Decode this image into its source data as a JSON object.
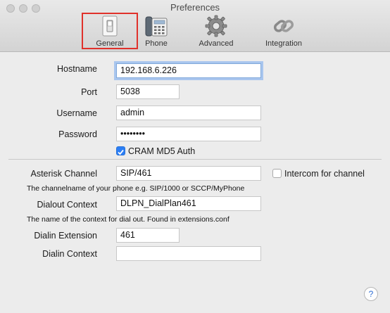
{
  "window": {
    "title": "Preferences",
    "close_button": "",
    "minimize_button": "",
    "zoom_button": ""
  },
  "toolbar": {
    "general_label": "General",
    "phone_label": "Phone",
    "advanced_label": "Advanced",
    "integration_label": "Integration",
    "selected": "General"
  },
  "general": {
    "hostname_label": "Hostname",
    "hostname_value": "192.168.6.226",
    "port_label": "Port",
    "port_value": "5038",
    "username_label": "Username",
    "username_value": "admin",
    "password_label": "Password",
    "password_value": "••••••••",
    "cram_label": "CRAM MD5 Auth",
    "cram_checked": true,
    "asterisk_channel_label": "Asterisk Channel",
    "asterisk_channel_value": "SIP/461",
    "intercom_label": "Intercom for channel",
    "intercom_checked": false,
    "channel_hint": "The channelname of your phone e.g. SIP/1000 or SCCP/MyPhone",
    "dialout_context_label": "Dialout Context",
    "dialout_context_value": "DLPN_DialPlan461",
    "context_hint": "The name of the context for dial out. Found in extensions.conf",
    "dialin_extension_label": "Dialin Extension",
    "dialin_extension_value": "461",
    "dialin_context_label": "Dialin Context",
    "dialin_context_value": "",
    "help_label": "?"
  },
  "colors": {
    "selection_outline": "#e0312b",
    "checkbox_accent": "#2b7ef5",
    "focus_ring": "#a9c6ee"
  }
}
